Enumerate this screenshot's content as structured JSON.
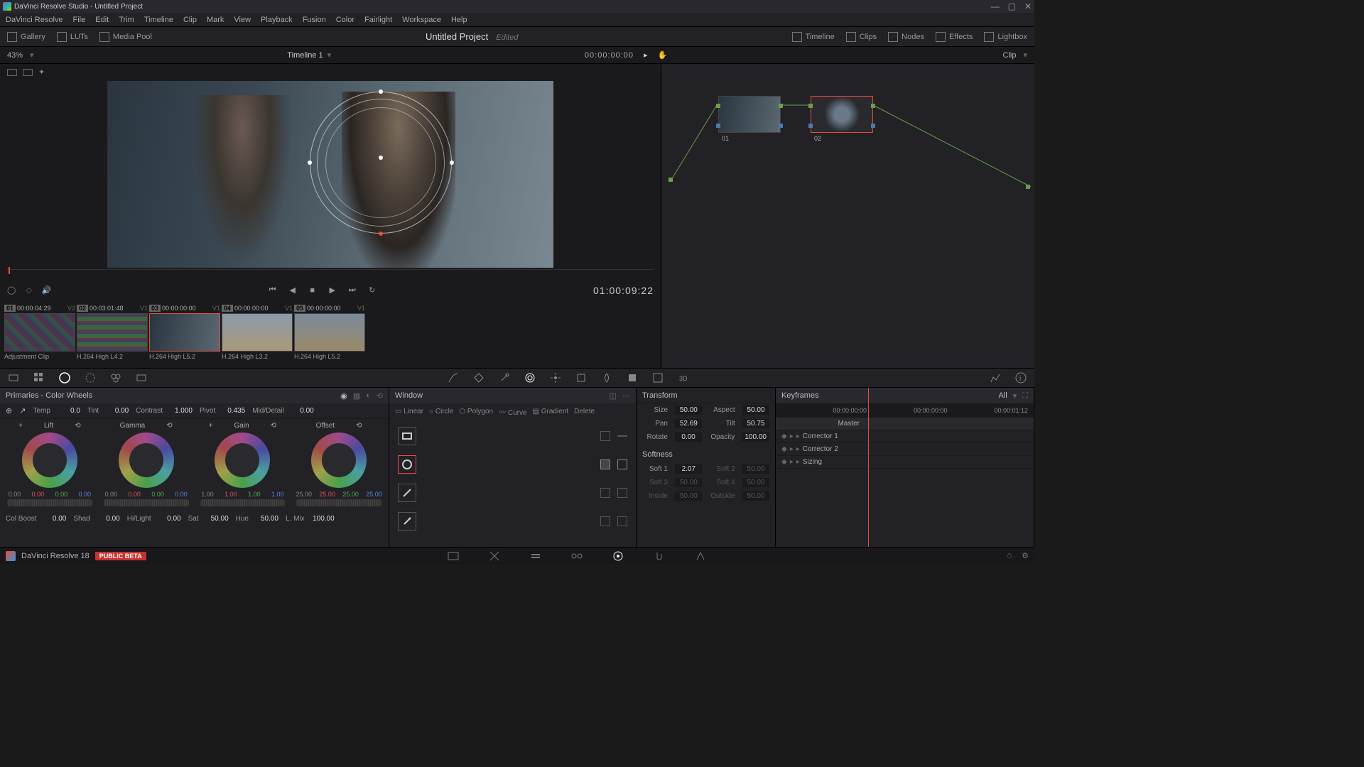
{
  "titlebar": {
    "title": "DaVinci Resolve Studio - Untitled Project"
  },
  "menubar": [
    "DaVinci Resolve",
    "File",
    "Edit",
    "Trim",
    "Timeline",
    "Clip",
    "Mark",
    "View",
    "Playback",
    "Fusion",
    "Color",
    "Fairlight",
    "Workspace",
    "Help"
  ],
  "toolbar": {
    "left": [
      {
        "label": "Gallery"
      },
      {
        "label": "LUTs"
      },
      {
        "label": "Media Pool"
      }
    ],
    "project": "Untitled Project",
    "edited": "Edited",
    "right": [
      {
        "label": "Timeline"
      },
      {
        "label": "Clips"
      },
      {
        "label": "Nodes"
      },
      {
        "label": "Effects"
      },
      {
        "label": "Lightbox"
      }
    ]
  },
  "subheader": {
    "zoom": "43%",
    "timeline_name": "Timeline 1",
    "timecode": "00:00:00:00",
    "clip": "Clip"
  },
  "transport": {
    "timecode": "01:00:09:22"
  },
  "thumbs": [
    {
      "num": "01",
      "tc": "00:00:04:29",
      "v": "V2",
      "label": "Adjustment Clip"
    },
    {
      "num": "02",
      "tc": "00:03:01:48",
      "v": "V1",
      "label": "H.264 High L4.2"
    },
    {
      "num": "03",
      "tc": "00:00:00:00",
      "v": "V1",
      "label": "H.264 High L5.2",
      "selected": true
    },
    {
      "num": "04",
      "tc": "00:00:00:00",
      "v": "V1",
      "label": "H.264 High L3.2"
    },
    {
      "num": "05",
      "tc": "00:00:00:00",
      "v": "V1",
      "label": "H.264 High L5.2"
    }
  ],
  "nodes": [
    {
      "label": "01"
    },
    {
      "label": "02"
    }
  ],
  "primaries": {
    "title": "Primaries - Color Wheels",
    "params_top": {
      "temp_l": "Temp",
      "temp": "0.0",
      "tint_l": "Tint",
      "tint": "0.00",
      "contrast_l": "Contrast",
      "contrast": "1.000",
      "pivot_l": "Pivot",
      "pivot": "0.435",
      "mid_l": "Mid/Detail",
      "mid": "0.00"
    },
    "wheels": {
      "lift": {
        "title": "Lift",
        "vals": [
          "0.00",
          "0.00",
          "0.00",
          "0.00"
        ]
      },
      "gamma": {
        "title": "Gamma",
        "vals": [
          "0.00",
          "0.00",
          "0.00",
          "0.00"
        ]
      },
      "gain": {
        "title": "Gain",
        "vals": [
          "1.00",
          "1.00",
          "1.00",
          "1.00"
        ]
      },
      "offset": {
        "title": "Offset",
        "vals": [
          "25.00",
          "25.00",
          "25.00",
          "25.00"
        ]
      }
    },
    "params_bottom": {
      "colboost_l": "Col Boost",
      "colboost": "0.00",
      "shad_l": "Shad",
      "shad": "0.00",
      "hilight_l": "Hi/Light",
      "hilight": "0.00",
      "sat_l": "Sat",
      "sat": "50.00",
      "hue_l": "Hue",
      "hue": "50.00",
      "lmix_l": "L. Mix",
      "lmix": "100.00"
    }
  },
  "window": {
    "title": "Window",
    "tabs": {
      "linear": "Linear",
      "circle": "Circle",
      "polygon": "Polygon",
      "curve": "Curve",
      "gradient": "Gradient",
      "delete": "Delete"
    }
  },
  "transform": {
    "title": "Transform",
    "size_l": "Size",
    "size": "50.00",
    "aspect_l": "Aspect",
    "aspect": "50.00",
    "pan_l": "Pan",
    "pan": "52.69",
    "tilt_l": "Tilt",
    "tilt": "50.75",
    "rotate_l": "Rotate",
    "rotate": "0.00",
    "opacity_l": "Opacity",
    "opacity": "100.00",
    "softness_title": "Softness",
    "soft1_l": "Soft 1",
    "soft1": "2.07",
    "soft2_l": "Soft 2",
    "soft2": "50.00",
    "soft3_l": "Soft 3",
    "soft3": "50.00",
    "soft4_l": "Soft 4",
    "soft4": "50.00",
    "inside_l": "Inside",
    "inside": "50.00",
    "outside_l": "Outside",
    "outside": "50.00"
  },
  "keyframes": {
    "title": "Keyframes",
    "all": "All",
    "tc_start": "00:00:00:00",
    "tc_mid": "00:00:00:00",
    "tc_end": "00:00:01:12",
    "master": "Master",
    "rows": [
      "Corrector 1",
      "Corrector 2",
      "Sizing"
    ]
  },
  "footer": {
    "version": "DaVinci Resolve 18",
    "beta": "PUBLIC BETA"
  }
}
